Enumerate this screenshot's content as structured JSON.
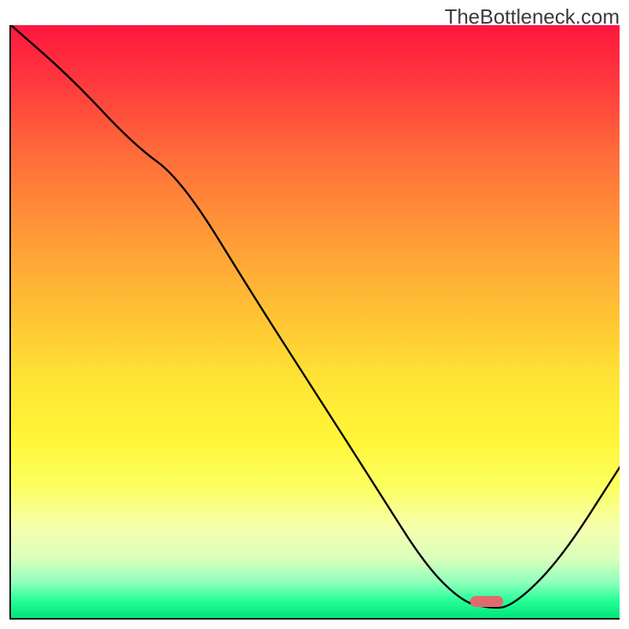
{
  "watermark": "TheBottleneck.com",
  "colors": {
    "curve_stroke": "#000000",
    "marker_fill": "#e36a6c",
    "axis": "#000000"
  },
  "chart_data": {
    "type": "line",
    "title": "",
    "xlabel": "",
    "ylabel": "",
    "xlim": [
      0,
      100
    ],
    "ylim": [
      0,
      100
    ],
    "x": [
      0,
      10,
      20,
      28,
      40,
      50,
      60,
      68,
      74,
      78,
      82,
      90,
      100
    ],
    "values": [
      100,
      91,
      80,
      74,
      54,
      38,
      22,
      9,
      3,
      2,
      2,
      10,
      26
    ],
    "annotations": [
      {
        "name": "optimal-marker",
        "x": 78,
        "y": 3,
        "color": "#e36a6c",
        "shape": "rounded-bar"
      }
    ],
    "background": "vertical-gradient red→yellow→green",
    "watermark": "TheBottleneck.com"
  }
}
